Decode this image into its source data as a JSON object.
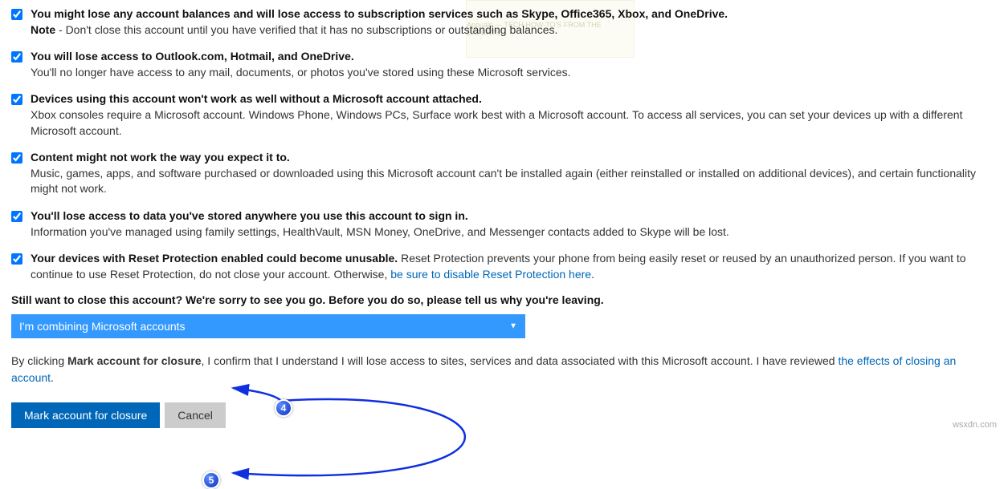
{
  "items": [
    {
      "title": "You might lose any account balances and will lose access to subscription services such as Skype, Office365, Xbox, and OneDrive.",
      "note_label": "Note",
      "desc": " - Don't close this account until you have verified that it has no subscriptions or outstanding balances."
    },
    {
      "title": "You will lose access to Outlook.com, Hotmail, and OneDrive.",
      "desc": "You'll no longer have access to any mail, documents, or photos you've stored using these Microsoft services."
    },
    {
      "title": "Devices using this account won't work as well without a Microsoft account attached.",
      "desc": "Xbox consoles require a Microsoft account. Windows Phone, Windows PCs, Surface work best with a Microsoft account. To access all services, you can set your devices up with a different Microsoft account."
    },
    {
      "title": "Content might not work the way you expect it to.",
      "desc": "Music, games, apps, and software purchased or downloaded using this Microsoft account can't be installed again (either reinstalled or installed on additional devices), and certain functionality might not work."
    },
    {
      "title": "You'll lose access to data you've stored anywhere you use this account to sign in.",
      "desc": "Information you've managed using family settings, HealthVault, MSN Money, OneDrive, and Messenger contacts added to Skype will be lost."
    },
    {
      "title": "Your devices with Reset Protection enabled could become unusable.",
      "inline_desc": " Reset Protection prevents your phone from being easily reset or reused by an unauthorized person. If you want to continue to use Reset Protection, do not close your account. Otherwise, ",
      "link": "be sure to disable Reset Protection here",
      "tail": "."
    }
  ],
  "question": "Still want to close this account? We're sorry to see you go. Before you do so, please tell us why you're leaving.",
  "reason_selected": "I'm combining Microsoft accounts",
  "confirm": {
    "pre": "By clicking ",
    "bold": "Mark account for closure",
    "mid": ", I confirm that I understand I will lose access to sites, services and data associated with this Microsoft account. I have reviewed ",
    "link": "the effects of closing an account",
    "tail": "."
  },
  "buttons": {
    "primary": "Mark account for closure",
    "secondary": "Cancel"
  },
  "watermark": "wsxdn.com",
  "logo": "Appuals — TECH HOW-TO'S FROM THE EXPERTS!",
  "annotations": {
    "badge4": "4",
    "badge5": "5"
  }
}
